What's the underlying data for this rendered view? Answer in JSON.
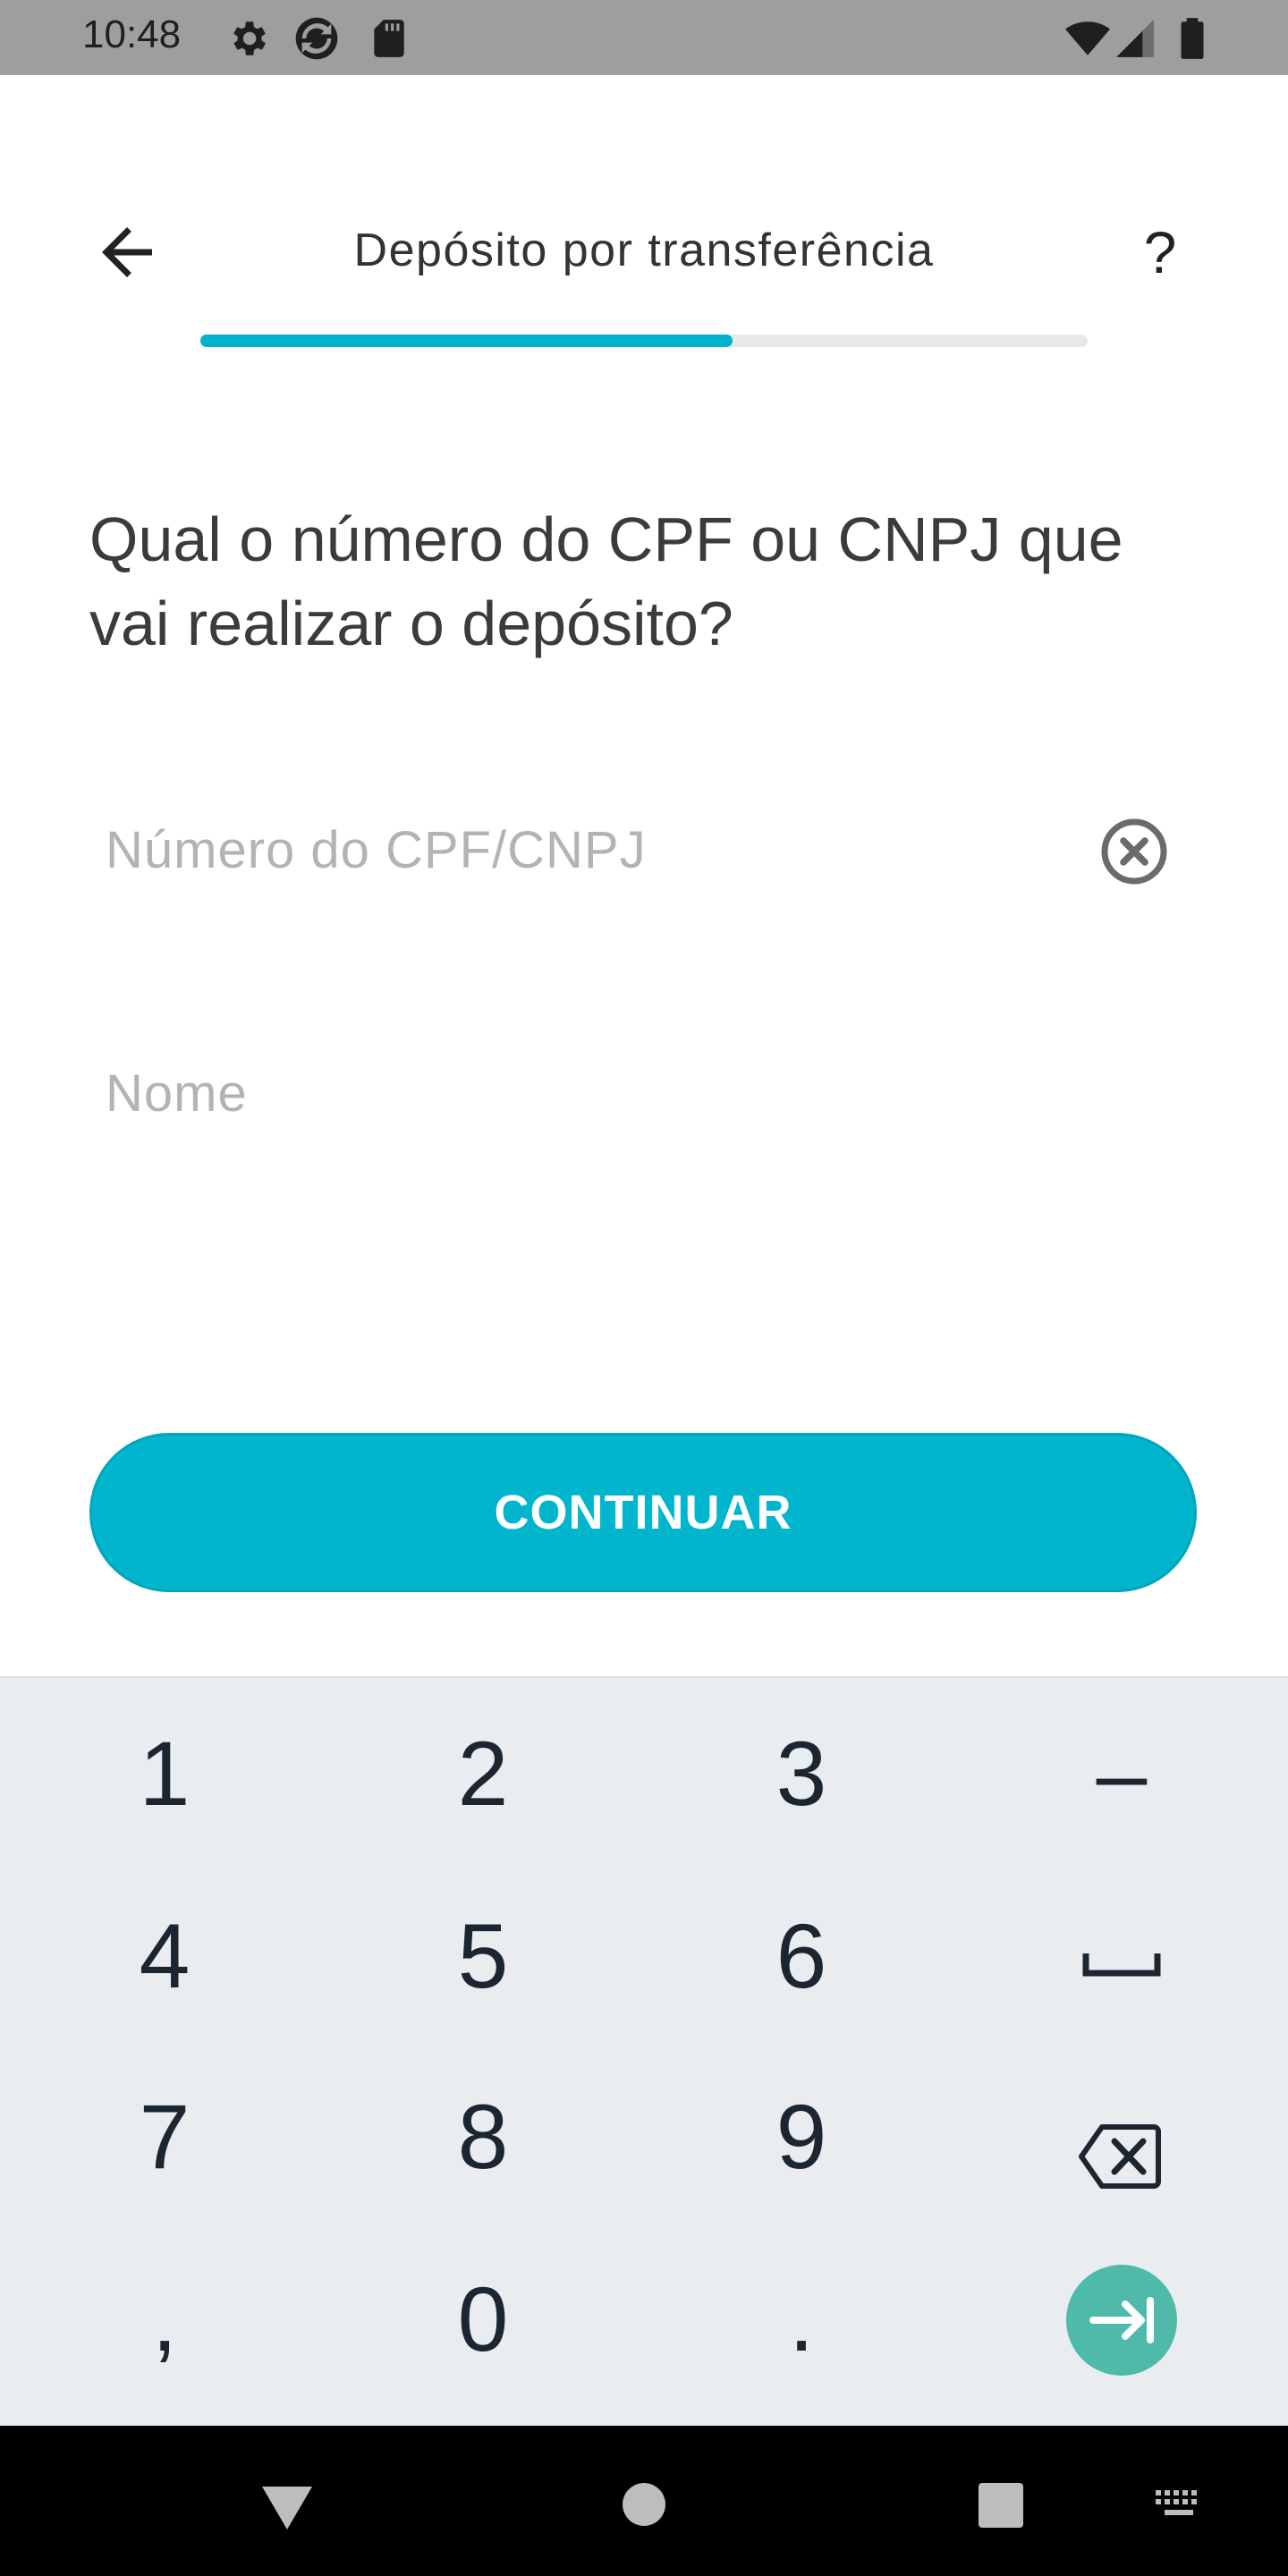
{
  "status_bar": {
    "time": "10:48",
    "icons_left": [
      "gear-icon",
      "sync-icon",
      "sd-card-icon"
    ],
    "icons_right": [
      "wifi-icon",
      "cell-signal-icon",
      "battery-icon"
    ]
  },
  "header": {
    "title": "Depósito por transferência",
    "help_label": "?",
    "progress": 0.6
  },
  "question": "Qual o número do CPF ou CNPJ que vai realizar o depósito?",
  "form": {
    "document_placeholder": "Número do CPF/CNPJ",
    "document_value": "",
    "name_placeholder": "Nome",
    "name_value": ""
  },
  "continue_label": "CONTINUAR",
  "keyboard": {
    "keys": [
      "1",
      "2",
      "3",
      "–",
      "4",
      "5",
      "6",
      "7",
      "8",
      "9",
      ",",
      "0",
      "."
    ]
  },
  "colors": {
    "accent": "#00b5cc",
    "keyboard_bg": "#e9edf0",
    "enter_key": "#4fb9aa"
  }
}
